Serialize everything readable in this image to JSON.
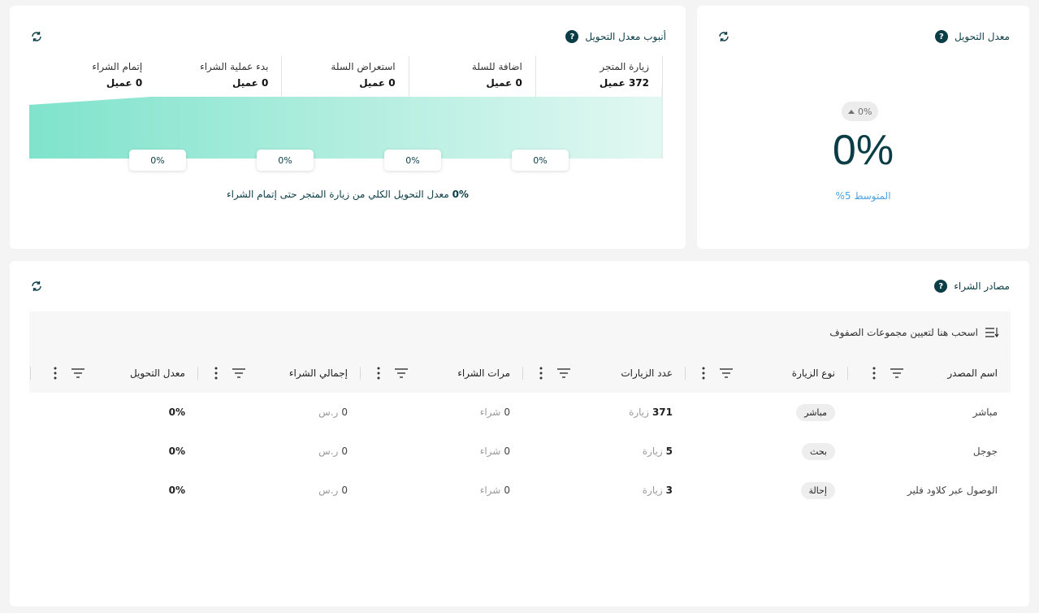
{
  "kpi_card": {
    "title": "معدل التحويل",
    "help": "?",
    "delta": "0%",
    "value": "0%",
    "average": "المتوسط 5%"
  },
  "funnel_card": {
    "title": "أنبوب معدل التحويل",
    "help": "?",
    "stages": [
      {
        "name": "زيارة المتجر",
        "value": "372 عميل"
      },
      {
        "name": "اضافة للسلة",
        "value": "0 عميل"
      },
      {
        "name": "استعراض السلة",
        "value": "0 عميل"
      },
      {
        "name": "بدء عملية الشراء",
        "value": "0 عميل"
      },
      {
        "name": "إتمام الشراء",
        "value": "0 عميل"
      }
    ],
    "step_rates": [
      "0%",
      "0%",
      "0%",
      "0%"
    ],
    "summary_value": "0%",
    "summary_text": "معدل التحويل الكلي من زيارة المتجر حتى إتمام الشراء"
  },
  "sources_card": {
    "title": "مصادر الشراء",
    "help": "?",
    "group_hint": "اسحب هنا لتعيين مجموعات الصفوف",
    "columns": [
      "اسم المصدر",
      "نوع الزيارة",
      "عدد الزيارات",
      "مرات الشراء",
      "إجمالي الشراء",
      "معدل التحويل"
    ],
    "rows": [
      {
        "source": "مباشر",
        "type": "مباشر",
        "visits": "371",
        "visits_unit": "زيارة",
        "purchases": "0",
        "purchases_unit": "شراء",
        "total": "0",
        "total_unit": "ر.س",
        "rate": "0%"
      },
      {
        "source": "جوجل",
        "type": "بحث",
        "visits": "5",
        "visits_unit": "زيارة",
        "purchases": "0",
        "purchases_unit": "شراء",
        "total": "0",
        "total_unit": "ر.س",
        "rate": "0%"
      },
      {
        "source": "الوصول عبر كلاود فلير",
        "type": "إحالة",
        "visits": "3",
        "visits_unit": "زيارة",
        "purchases": "0",
        "purchases_unit": "شراء",
        "total": "0",
        "total_unit": "ر.س",
        "rate": "0%"
      }
    ]
  },
  "colors": {
    "primary": "#0b3d46",
    "accent": "#4da3e0",
    "funnel_start": "#7fe3cc",
    "funnel_end": "#d9f7ef"
  }
}
